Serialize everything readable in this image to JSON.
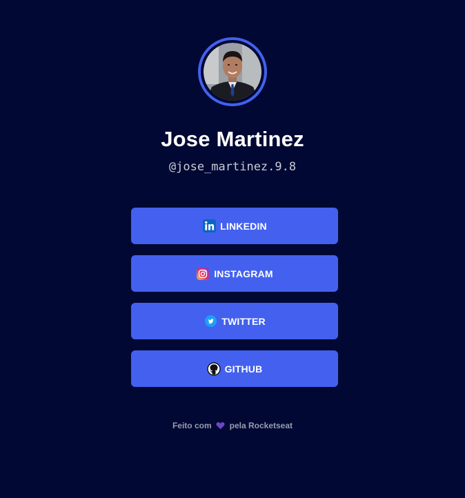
{
  "profile": {
    "name": "Jose Martinez",
    "handle": "@jose_martinez.9.8"
  },
  "links": [
    {
      "label": "LINKEDIN",
      "icon": "linkedin-icon"
    },
    {
      "label": "INSTAGRAM",
      "icon": "instagram-icon"
    },
    {
      "label": "TWITTER",
      "icon": "twitter-icon"
    },
    {
      "label": "GITHUB",
      "icon": "github-icon"
    }
  ],
  "footer": {
    "prefix": "Feito com",
    "suffix": "pela Rocketseat",
    "icon": "heart-icon"
  },
  "colors": {
    "background": "#000833",
    "accent": "#4361ee",
    "heart": "#6b46c1"
  }
}
